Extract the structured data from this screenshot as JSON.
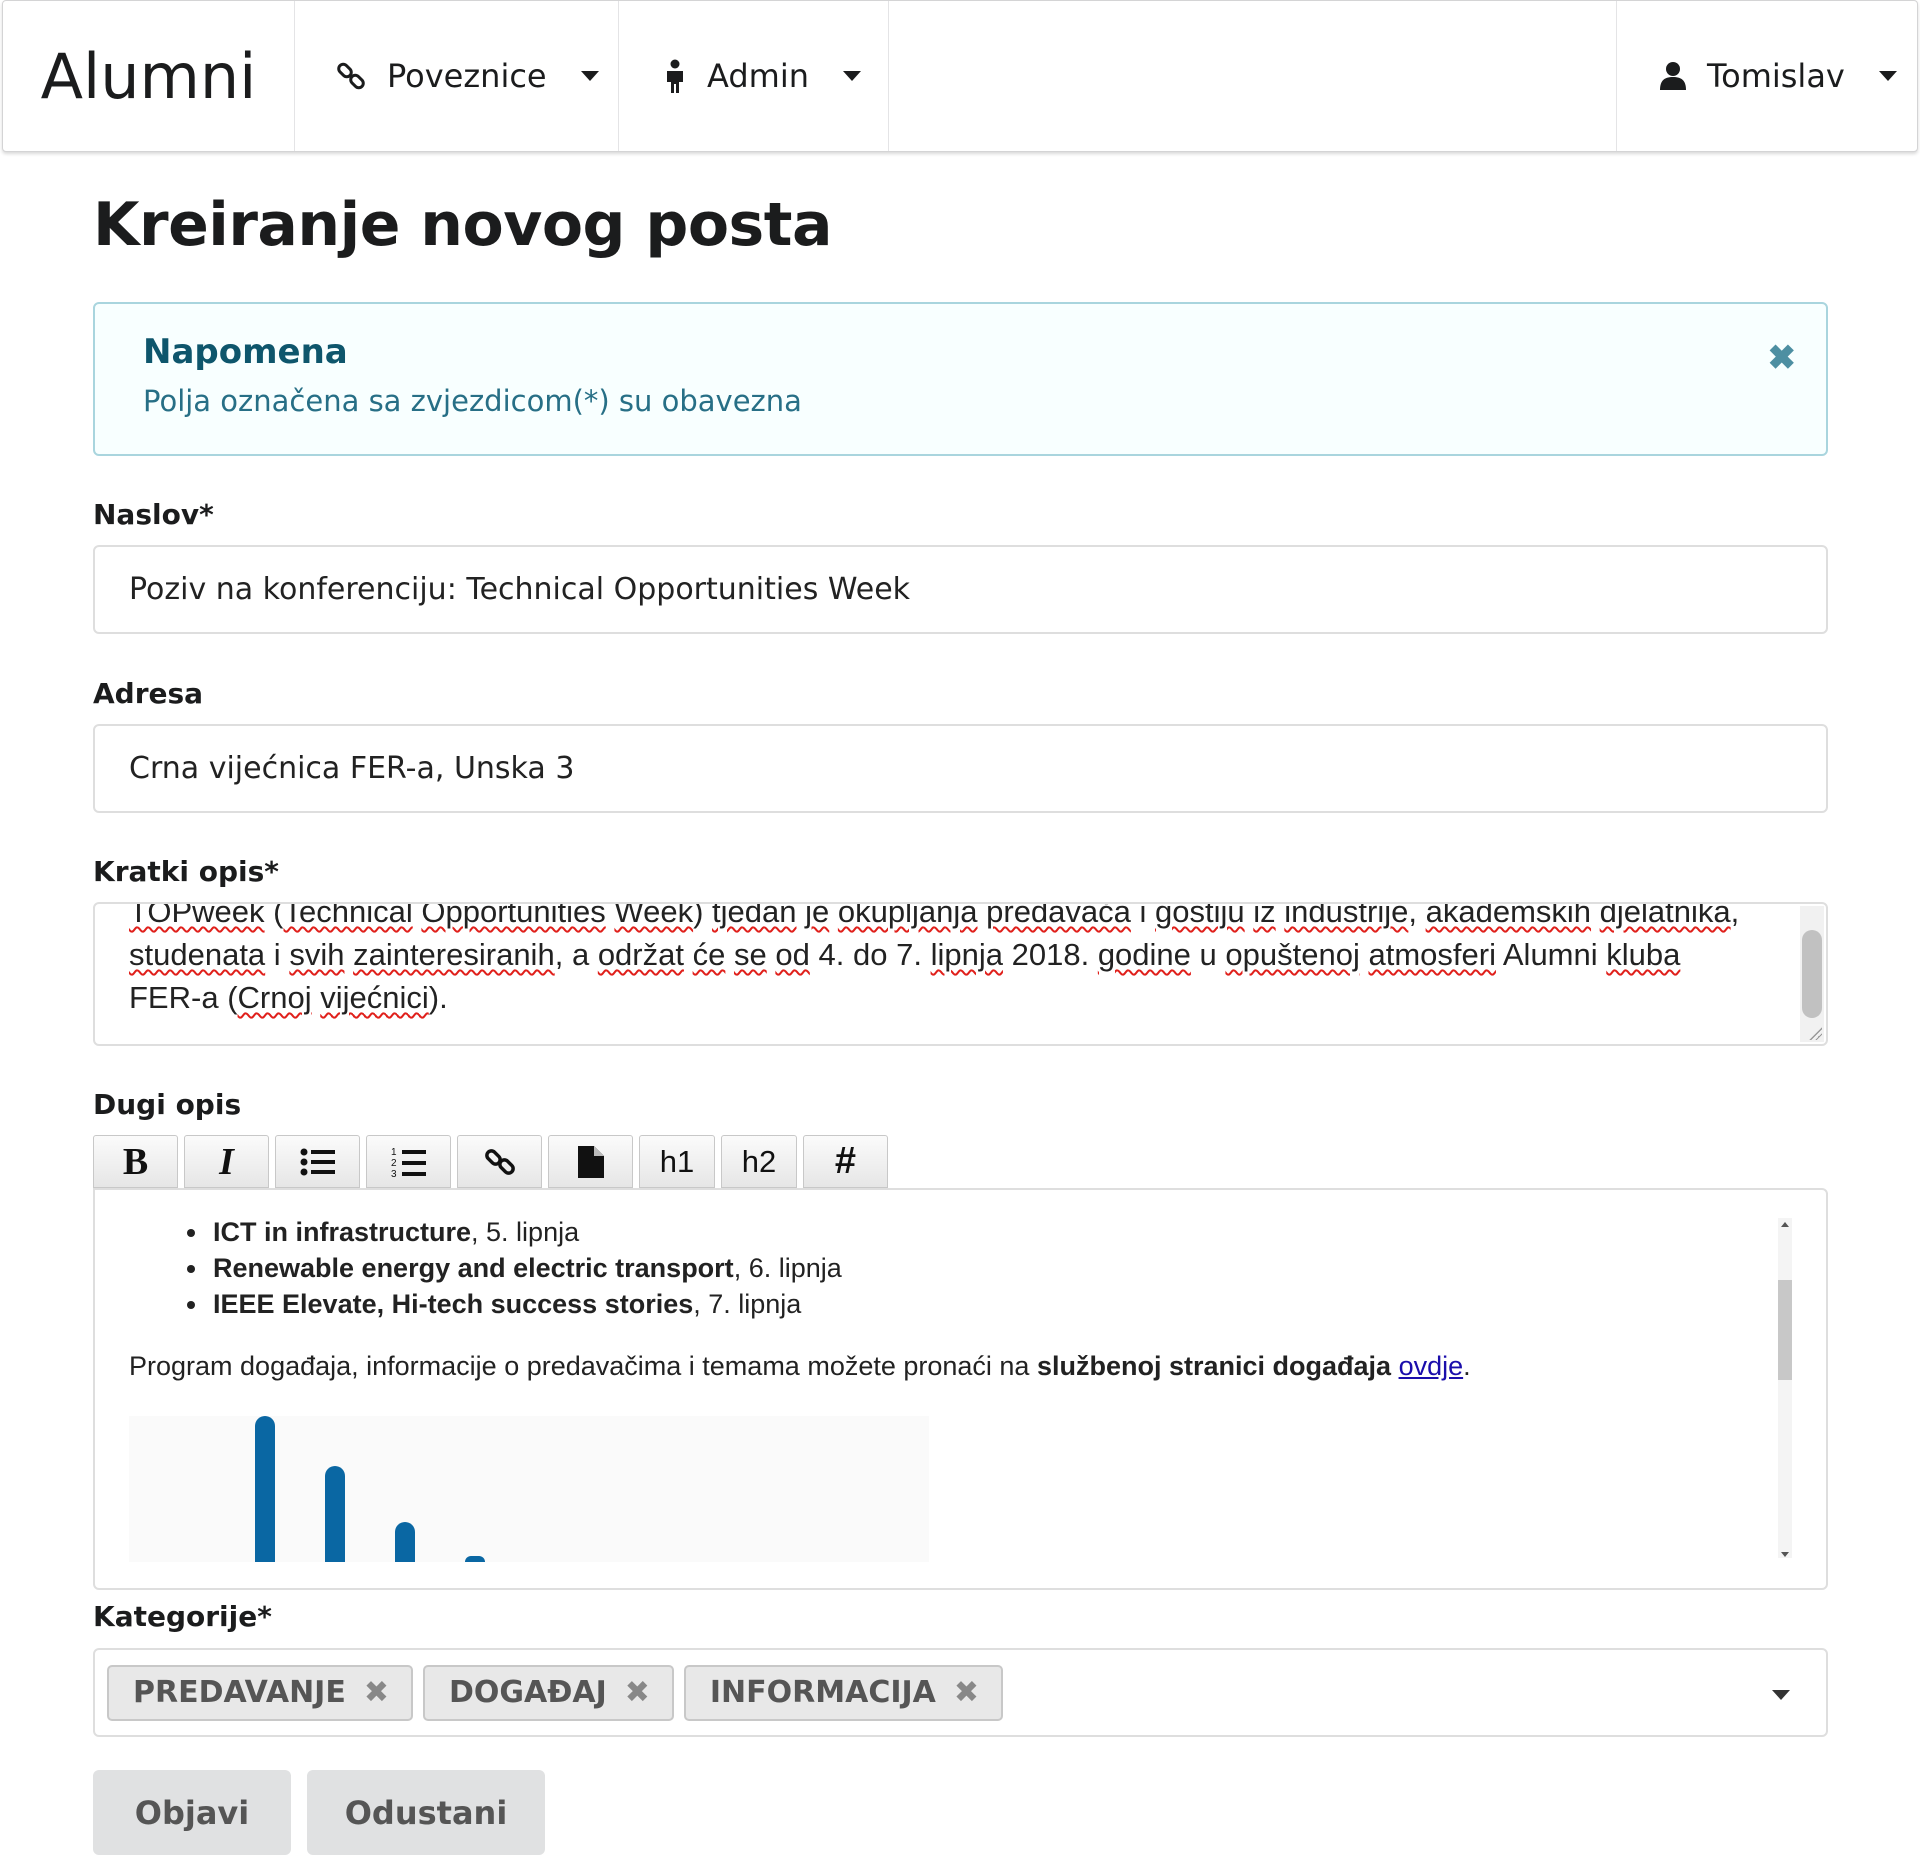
{
  "navbar": {
    "brand": "Alumni",
    "menus": [
      {
        "label": "Poveznice",
        "icon": "link-icon"
      },
      {
        "label": "Admin",
        "icon": "person-icon"
      }
    ],
    "user": {
      "label": "Tomislav",
      "icon": "user-icon"
    }
  },
  "page": {
    "title": "Kreiranje novog posta"
  },
  "notice": {
    "title": "Napomena",
    "text": "Polja označena sa zvjezdicom(*) su obavezna"
  },
  "form": {
    "naslov": {
      "label": "Naslov*",
      "value": "Poziv na konferenciju: Technical Opportunities Week"
    },
    "adresa": {
      "label": "Adresa",
      "value": "Crna vijećnica FER-a, Unska 3"
    },
    "kratki_opis": {
      "label": "Kratki opis*",
      "value": "TOPweek (Technical Opportunities Week) tjedan je okupljanja predavača i gostiju iz industrije, akademskih djelatnika, studenata i svih zainteresiranih, a održat će se od 4. do 7. lipnja 2018. godine u opuštenoj atmosferi Alumni kluba FER-a (Crnoj vijećnici)."
    },
    "dugi_opis": {
      "label": "Dugi opis",
      "toolbar": [
        "B",
        "I",
        "bullet-list",
        "numbered-list",
        "link",
        "file",
        "h1",
        "h2",
        "#"
      ],
      "list": [
        {
          "bold": "ICT in infrastructure",
          "rest": ", 5. lipnja"
        },
        {
          "bold": "Renewable energy and electric transport",
          "rest": ", 6. lipnja"
        },
        {
          "bold": "IEEE Elevate, Hi-tech success stories",
          "rest": ", 7. lipnja"
        }
      ],
      "paragraph": {
        "text": "Program događaja, informacije o predavačima i temama možete pronaći na ",
        "bold": "službenoj stranici događaja",
        "link": "ovdje",
        "end": "."
      }
    },
    "kategorije": {
      "label": "Kategorije*",
      "selected": [
        "PREDAVANJE",
        "DOGAĐAJ",
        "INFORMACIJA"
      ]
    },
    "buttons": {
      "submit": "Objavi",
      "cancel": "Odustani"
    }
  },
  "colors": {
    "notice_bg": "#f8ffff",
    "notice_border": "#a9d5de",
    "notice_title": "#0e566c",
    "notice_text": "#276f86",
    "button_bg": "#e0e1e2",
    "spellcheck": "#e0201b",
    "link": "#1a0dab"
  }
}
